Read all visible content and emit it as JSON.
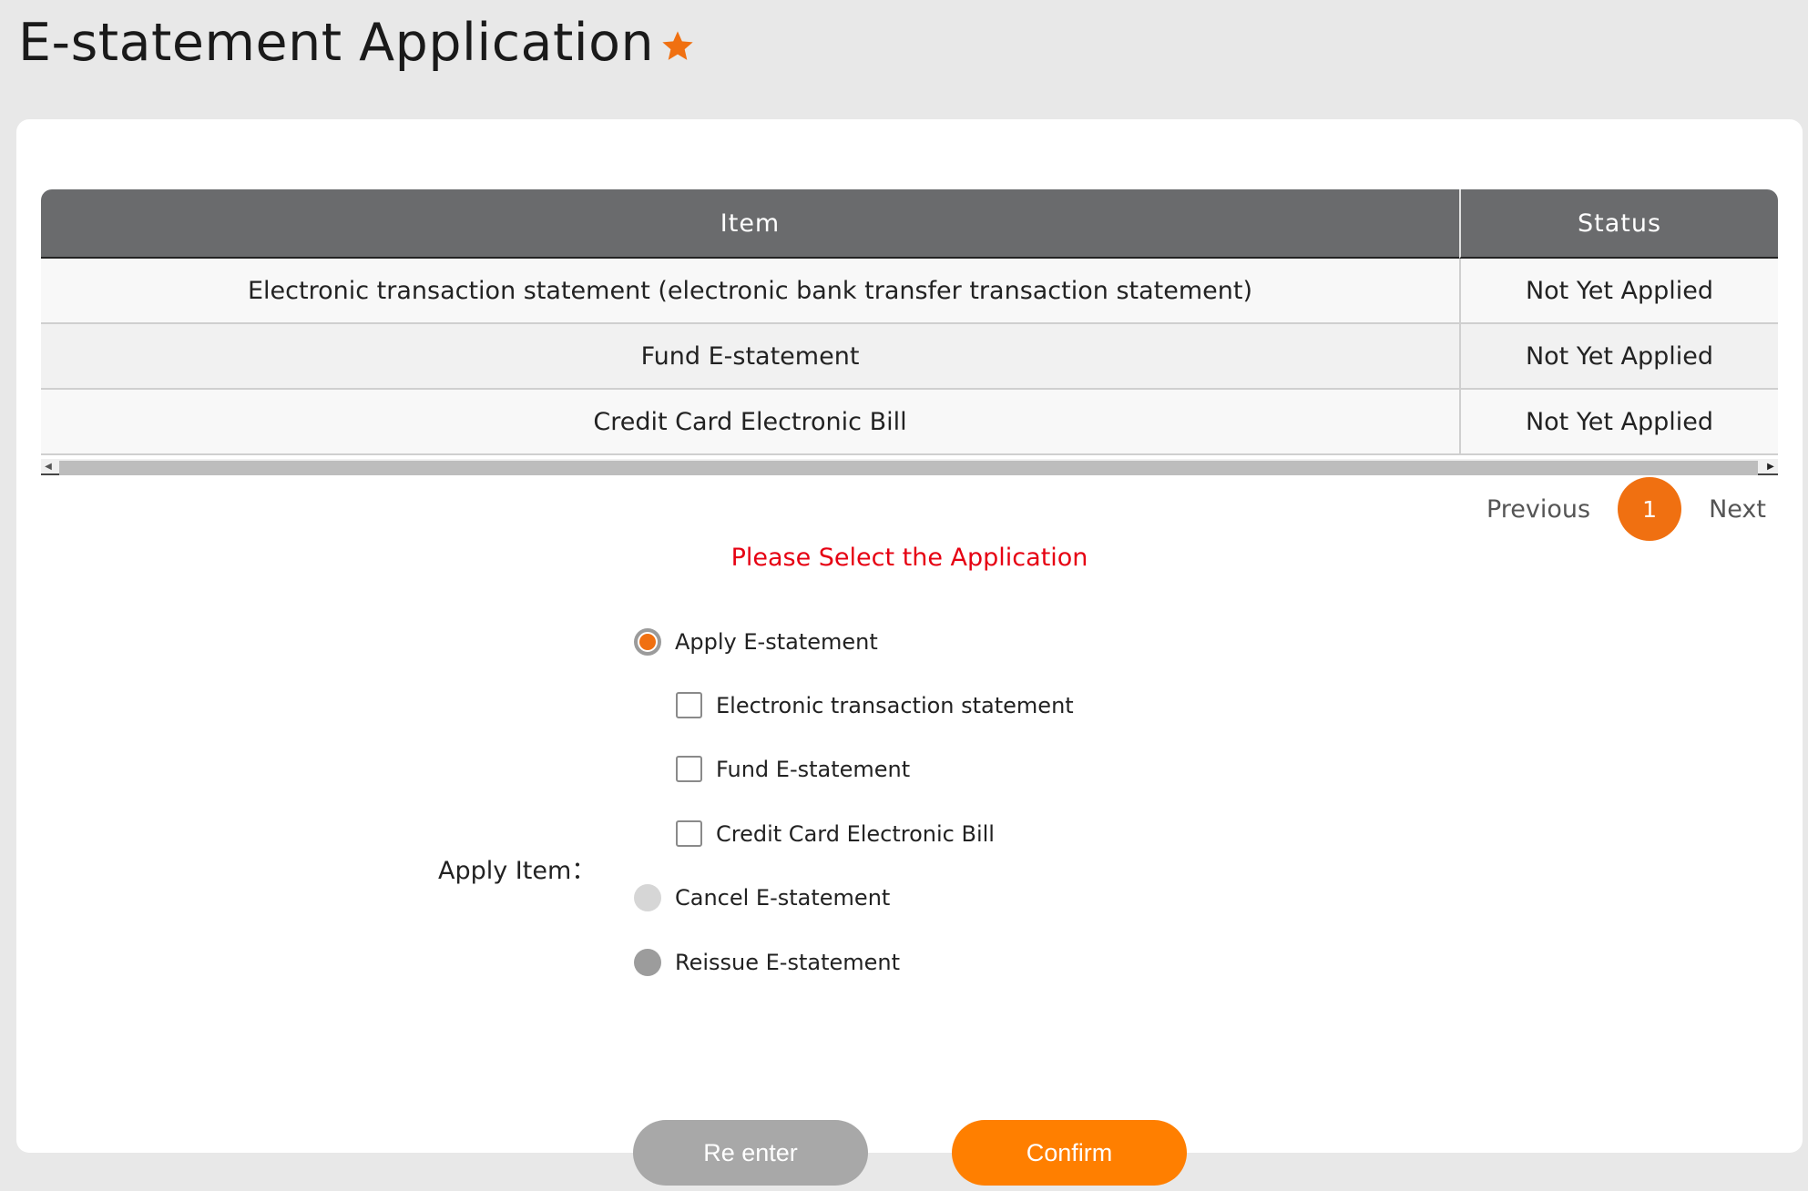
{
  "page": {
    "title": "E-statement Application",
    "accent_color": "#f07011"
  },
  "table": {
    "headers": [
      "Item",
      "Status"
    ],
    "rows": [
      {
        "item": "Electronic transaction statement (electronic bank transfer transaction statement)",
        "status": "Not Yet Applied"
      },
      {
        "item": "Fund E-statement",
        "status": "Not Yet Applied"
      },
      {
        "item": "Credit Card Electronic Bill",
        "status": "Not Yet Applied"
      }
    ]
  },
  "pagination": {
    "previous_label": "Previous",
    "current_page": "1",
    "next_label": "Next"
  },
  "form": {
    "warning": "Please Select the Application",
    "apply_item_label": "Apply Item：",
    "options": {
      "apply": "Apply E-statement",
      "apply_sub": [
        "Electronic transaction statement",
        "Fund E-statement",
        "Credit Card Electronic Bill"
      ],
      "cancel": "Cancel E-statement",
      "reissue": "Reissue E-statement"
    },
    "selected_option": "Apply E-statement"
  },
  "buttons": {
    "reenter": "Re enter",
    "confirm": "Confirm"
  },
  "colors": {
    "confirm": "#ff7f00",
    "reenter": "#a8a8a8",
    "warning": "#e60012",
    "table_header": "#6a6b6d"
  }
}
